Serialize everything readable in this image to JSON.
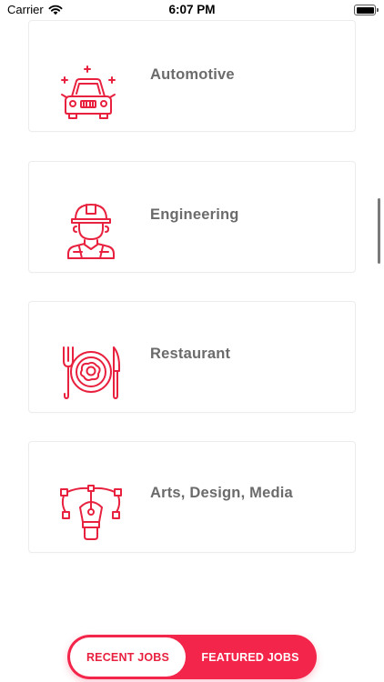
{
  "status_bar": {
    "carrier": "Carrier",
    "time": "6:07 PM"
  },
  "categories": [
    {
      "label": "Automotive",
      "icon": "car-icon"
    },
    {
      "label": "Engineering",
      "icon": "engineer-icon"
    },
    {
      "label": "Restaurant",
      "icon": "restaurant-icon"
    },
    {
      "label": "Arts, Design, Media",
      "icon": "pen-tool-icon"
    }
  ],
  "tabs": {
    "recent": "RECENT JOBS",
    "featured": "FEATURED JOBS",
    "active": "recent"
  },
  "colors": {
    "accent": "#f4254a",
    "icon": "#e8213f",
    "label_text": "#6b6b6b"
  }
}
